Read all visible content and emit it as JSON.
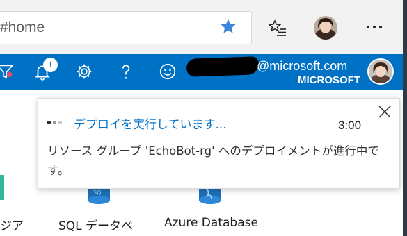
{
  "browser": {
    "address_text": "#home",
    "favorite_icon": "star-filled-icon",
    "favorites_icon": "favorites-list-icon",
    "menu_icon": "more-icon",
    "accent_color": "#3a86d8"
  },
  "azure_nav": {
    "background_color": "#0072c6",
    "icons": [
      "filter-icon",
      "notifications-bell-icon",
      "settings-gear-icon",
      "help-icon",
      "feedback-smiley-icon"
    ],
    "notification_count": "1",
    "account_email_suffix": "@microsoft.com",
    "account_org": "MICROSOFT"
  },
  "notification": {
    "title": "デプロイを実行しています...",
    "time": "3:00",
    "body": "リソース グループ 'EchoBot-rg' へのデプロイメントが進行中です。",
    "title_color": "#0072c6"
  },
  "services": [
    {
      "label": "ジア",
      "icon": "resource-tile-icon"
    },
    {
      "label": "SQL データベ",
      "icon": "sql-database-icon"
    },
    {
      "label": "Azure Database",
      "icon": "azure-database-icon"
    }
  ]
}
